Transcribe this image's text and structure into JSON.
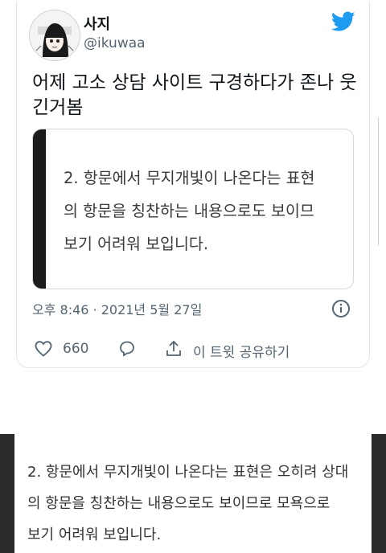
{
  "tweet": {
    "display_name": "사지",
    "handle": "@ikuwaa",
    "text_lines": [
      "어제 고소 상담 사이트 구경하다가 존나 웃",
      "긴거봄"
    ],
    "media_lines": [
      "2. 항문에서 무지개빛이 나온다는 표현",
      "의 항문을 칭찬하는 내용으로도 보이므",
      "보기 어려워 보입니다."
    ],
    "timestamp": "오후 8:46 · 2021년 5월 27일",
    "like_count": "660",
    "share_label": "이 트윗 공유하기",
    "brand_color": "#1d9bf0"
  },
  "excerpt": {
    "lines": [
      "2. 항문에서 무지개빛이 나온다는 표현은 오히려 상대",
      "의 항문을 칭찬하는 내용으로도 보이므로 모욕으로",
      "보기 어려워 보입니다."
    ]
  },
  "icons": [
    "twitter-bird-icon",
    "info-icon",
    "heart-icon",
    "reply-icon",
    "share-icon"
  ]
}
